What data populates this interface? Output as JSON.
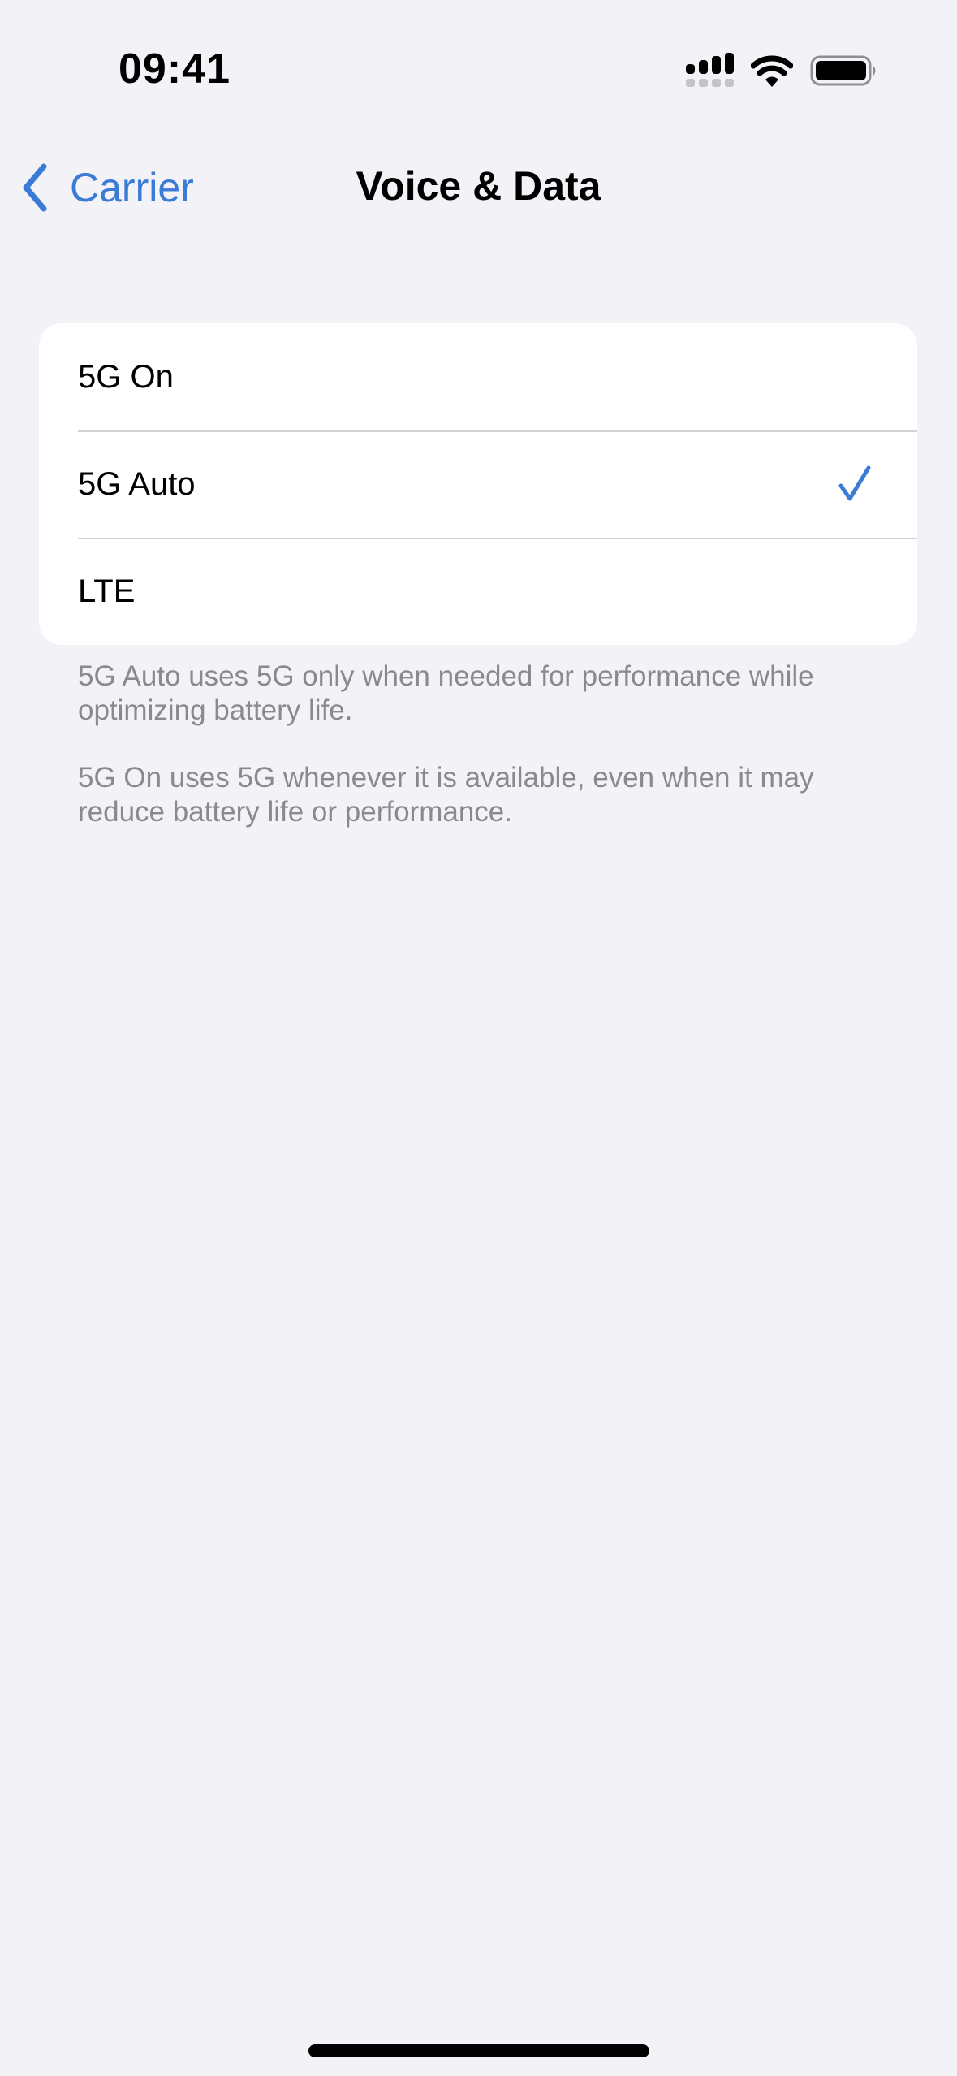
{
  "status_bar": {
    "time": "09:41",
    "icons": [
      "cellular-signal-icon",
      "wifi-icon",
      "battery-icon"
    ]
  },
  "nav": {
    "back_label": "Carrier",
    "back_icon": "chevron-left-icon",
    "title": "Voice & Data"
  },
  "options": [
    {
      "label": "5G On",
      "selected": false
    },
    {
      "label": "5G Auto",
      "selected": true
    },
    {
      "label": "LTE",
      "selected": false
    }
  ],
  "footer": {
    "auto_description": "5G Auto uses 5G only when needed for performance while optimizing battery life.",
    "on_description": "5G On uses 5G whenever it is available, even when it may reduce battery life or performance."
  },
  "colors": {
    "accent": "#3a7bd5",
    "background": "#f2f2f7",
    "card": "#ffffff",
    "secondary_text": "#8a8a8e",
    "separator": "#d1d1d6"
  }
}
